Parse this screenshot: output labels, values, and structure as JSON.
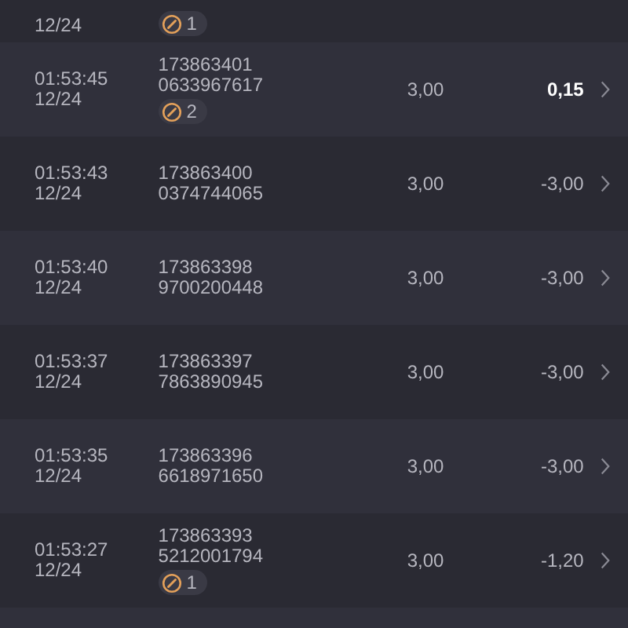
{
  "rows": [
    {
      "date": "12/24",
      "badge": "1",
      "partial": true
    },
    {
      "time": "01:53:45",
      "date": "12/24",
      "id": "173863401",
      "code": "0633967617",
      "badge": "2",
      "amount": "3,00",
      "result": "0,15",
      "emphasized": true
    },
    {
      "time": "01:53:43",
      "date": "12/24",
      "id": "173863400",
      "code": "0374744065",
      "amount": "3,00",
      "result": "-3,00",
      "emphasized": false
    },
    {
      "time": "01:53:40",
      "date": "12/24",
      "id": "173863398",
      "code": "9700200448",
      "amount": "3,00",
      "result": "-3,00",
      "emphasized": false
    },
    {
      "time": "01:53:37",
      "date": "12/24",
      "id": "173863397",
      "code": "7863890945",
      "amount": "3,00",
      "result": "-3,00",
      "emphasized": false
    },
    {
      "time": "01:53:35",
      "date": "12/24",
      "id": "173863396",
      "code": "6618971650",
      "amount": "3,00",
      "result": "-3,00",
      "emphasized": false
    },
    {
      "time": "01:53:27",
      "date": "12/24",
      "id": "173863393",
      "code": "5212001794",
      "badge": "1",
      "amount": "3,00",
      "result": "-1,20",
      "emphasized": false
    }
  ]
}
